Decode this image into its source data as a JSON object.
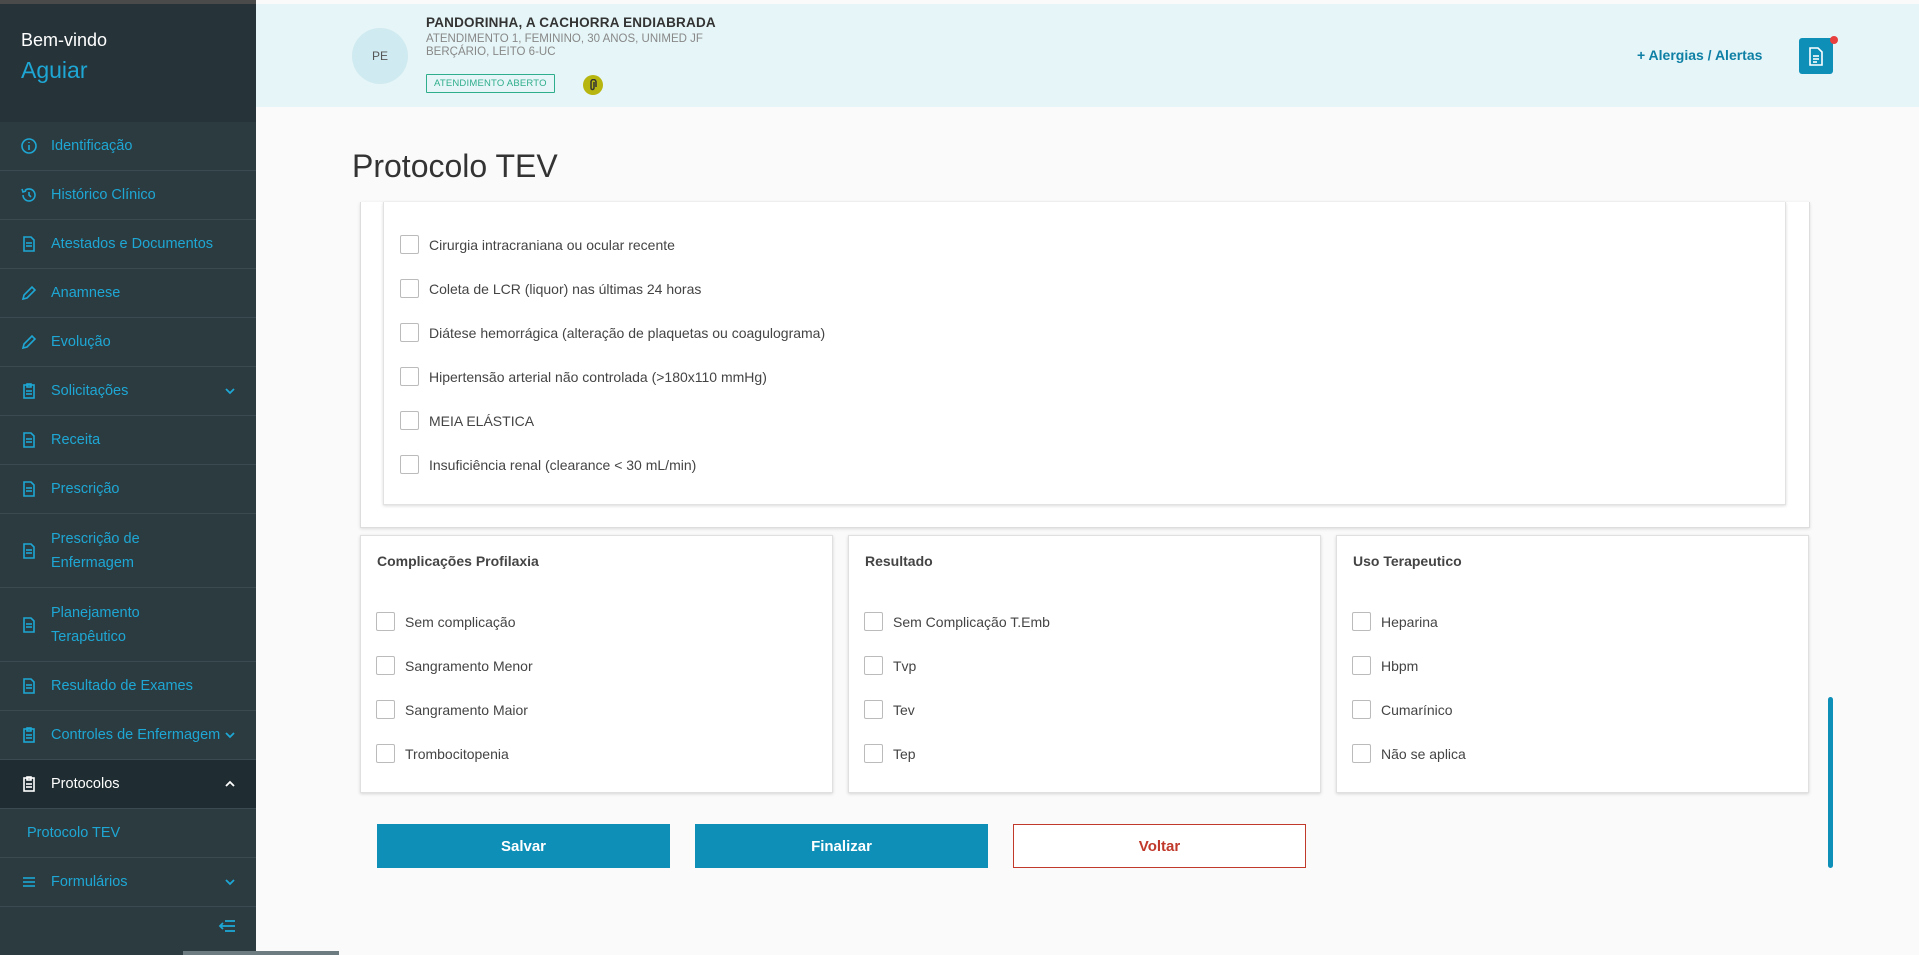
{
  "sidebar": {
    "welcome": "Bem-vindo",
    "user": "Aguiar",
    "items": [
      {
        "label": "Identificação",
        "icon": "info-icon"
      },
      {
        "label": "Histórico Clínico",
        "icon": "history-icon"
      },
      {
        "label": "Atestados e Documentos",
        "icon": "document-icon"
      },
      {
        "label": "Anamnese",
        "icon": "pencil-icon"
      },
      {
        "label": "Evolução",
        "icon": "pencil-icon"
      },
      {
        "label": "Solicitações",
        "icon": "clipboard-icon"
      },
      {
        "label": "Receita",
        "icon": "document-icon"
      },
      {
        "label": "Prescrição",
        "icon": "document-icon"
      },
      {
        "label": "Prescrição de Enfermagem",
        "icon": "document-icon"
      },
      {
        "label": "Planejamento Terapêutico",
        "icon": "document-icon"
      },
      {
        "label": "Resultado de Exames",
        "icon": "document-icon"
      },
      {
        "label": "Controles de Enfermagem",
        "icon": "clipboard-icon"
      },
      {
        "label": "Protocolos",
        "icon": "clipboard-icon"
      },
      {
        "label": "Formulários",
        "icon": "list-icon"
      }
    ],
    "sub_item": "Protocolo TEV"
  },
  "header": {
    "avatar": "PE",
    "patient_name": "PANDORINHA, A CACHORRA ENDIABRADA",
    "line1": "ATENDIMENTO 1, FEMININO, 30 ANOS, UNIMED JF",
    "line2": "BERÇÁRIO, LEITO 6-UC",
    "status_badge": "ATENDIMENTO ABERTO",
    "alerts_link": "+  Alergias / Alertas"
  },
  "main": {
    "title": "Protocolo TEV",
    "contraindications": [
      "Cirurgia intracraniana ou ocular recente",
      "Coleta de LCR (liquor) nas últimas 24 horas",
      "Diátese hemorrágica (alteração de plaquetas ou coagulograma)",
      "Hipertensão arterial não controlada (>180x110 mmHg)",
      "MEIA ELÁSTICA",
      "Insuficiência renal (clearance < 30 mL/min)"
    ],
    "cards": [
      {
        "title": "Complicações Profilaxia",
        "items": [
          "Sem complicação",
          "Sangramento Menor",
          "Sangramento Maior",
          "Trombocitopenia"
        ]
      },
      {
        "title": "Resultado",
        "items": [
          "Sem Complicação T.Emb",
          "Tvp",
          "Tev",
          "Tep"
        ]
      },
      {
        "title": "Uso Terapeutico",
        "items": [
          "Heparina",
          "Hbpm",
          "Cumarínico",
          "Não se aplica"
        ]
      }
    ],
    "buttons": {
      "save": "Salvar",
      "finish": "Finalizar",
      "back": "Voltar"
    }
  },
  "colors": {
    "accent": "#0e8fb8",
    "sidebar_bg": "#2c3b40",
    "header_bg": "#e6f5f7",
    "danger": "#c0392b",
    "badge": "#2fae8d"
  }
}
